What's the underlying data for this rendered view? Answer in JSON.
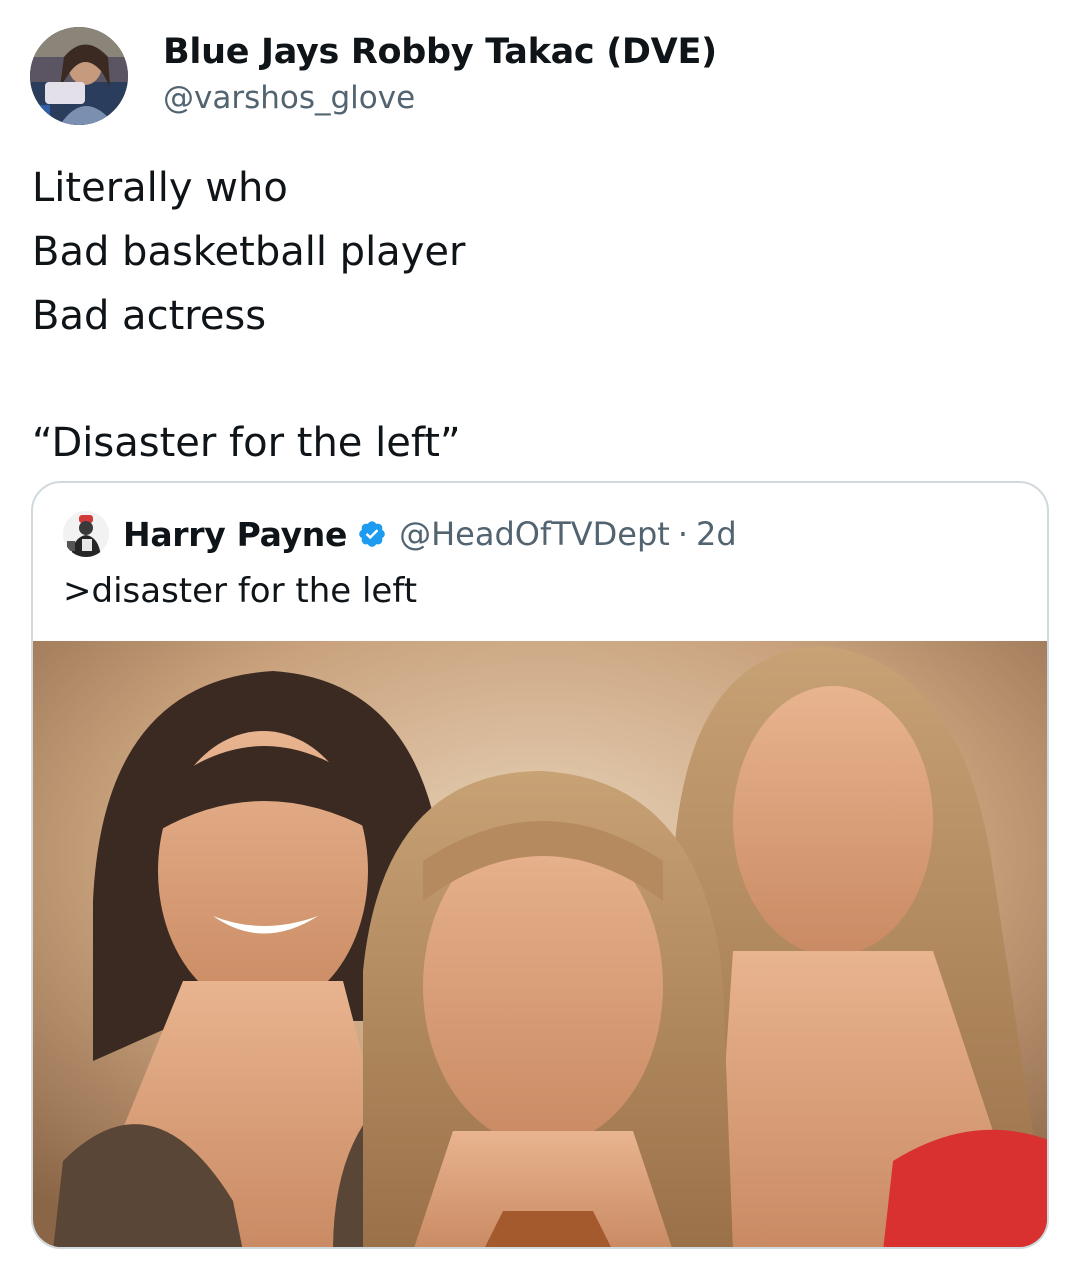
{
  "author": {
    "display_name": "Blue Jays Robby Takac (DVE)",
    "handle": "@varshos_glove",
    "avatar_icon": "profile-avatar"
  },
  "tweet_lines": [
    "Literally who",
    "Bad basketball player",
    "Bad actress",
    "“Disaster for the left”"
  ],
  "quoted_tweet": {
    "display_name": "Harry Payne",
    "verified_icon": "verified-badge-icon",
    "handle": "@HeadOfTVDept",
    "separator": "·",
    "time": "2d",
    "text": ">disaster for the left",
    "image_icon": "photo-three-women"
  },
  "colors": {
    "text_primary": "#0f1419",
    "text_secondary": "#536471",
    "border": "#cfd9de",
    "verified_blue": "#1d9bf0"
  }
}
